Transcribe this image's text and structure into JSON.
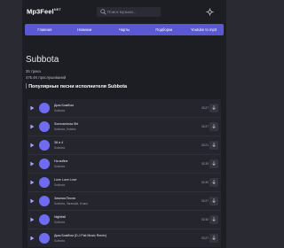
{
  "header": {
    "logo_main": "Mp3Feel",
    "logo_suffix": "NET",
    "search_placeholder": "Поиск музыки..."
  },
  "nav": {
    "items": [
      "Главная",
      "Новинки",
      "Чарты",
      "Подборки",
      "Youtube to mp3"
    ]
  },
  "artist": {
    "title": "Subbota",
    "tracks_count": "35 трека",
    "plays": "476.4K прослушиваний",
    "section_title": "Популярные песни исполнителя Subbota"
  },
  "tracks": [
    {
      "title": "Дым Бомбом",
      "artist": "Subbota",
      "duration": "03:27"
    },
    {
      "title": "Somnambula 5ht",
      "artist": "Subbota, Jinbeks",
      "duration": "02:27"
    },
    {
      "title": "38 и 4",
      "artist": "Subbota",
      "duration": "03:21"
    },
    {
      "title": "На войне",
      "artist": "Subbota",
      "duration": "02:39"
    },
    {
      "title": "Love Love Love",
      "artist": "Subbota",
      "duration": "02:30"
    },
    {
      "title": "Зимняя Песня",
      "artist": "Subbota, Лигалайз, Итака",
      "duration": "02:27"
    },
    {
      "title": "Nightfall",
      "artist": "Subbota",
      "duration": "02:30"
    },
    {
      "title": "Дым Бомбом (D.J Flat Music Remix)",
      "artist": "Subbota",
      "duration": "03:27"
    }
  ],
  "colors": {
    "accent": "#5b58d4",
    "background": "#1d1d24",
    "row": "#25252e"
  },
  "icons": {
    "search": "search-icon",
    "theme": "gear-icon",
    "play": "play-icon",
    "download": "chevron-down-icon"
  }
}
